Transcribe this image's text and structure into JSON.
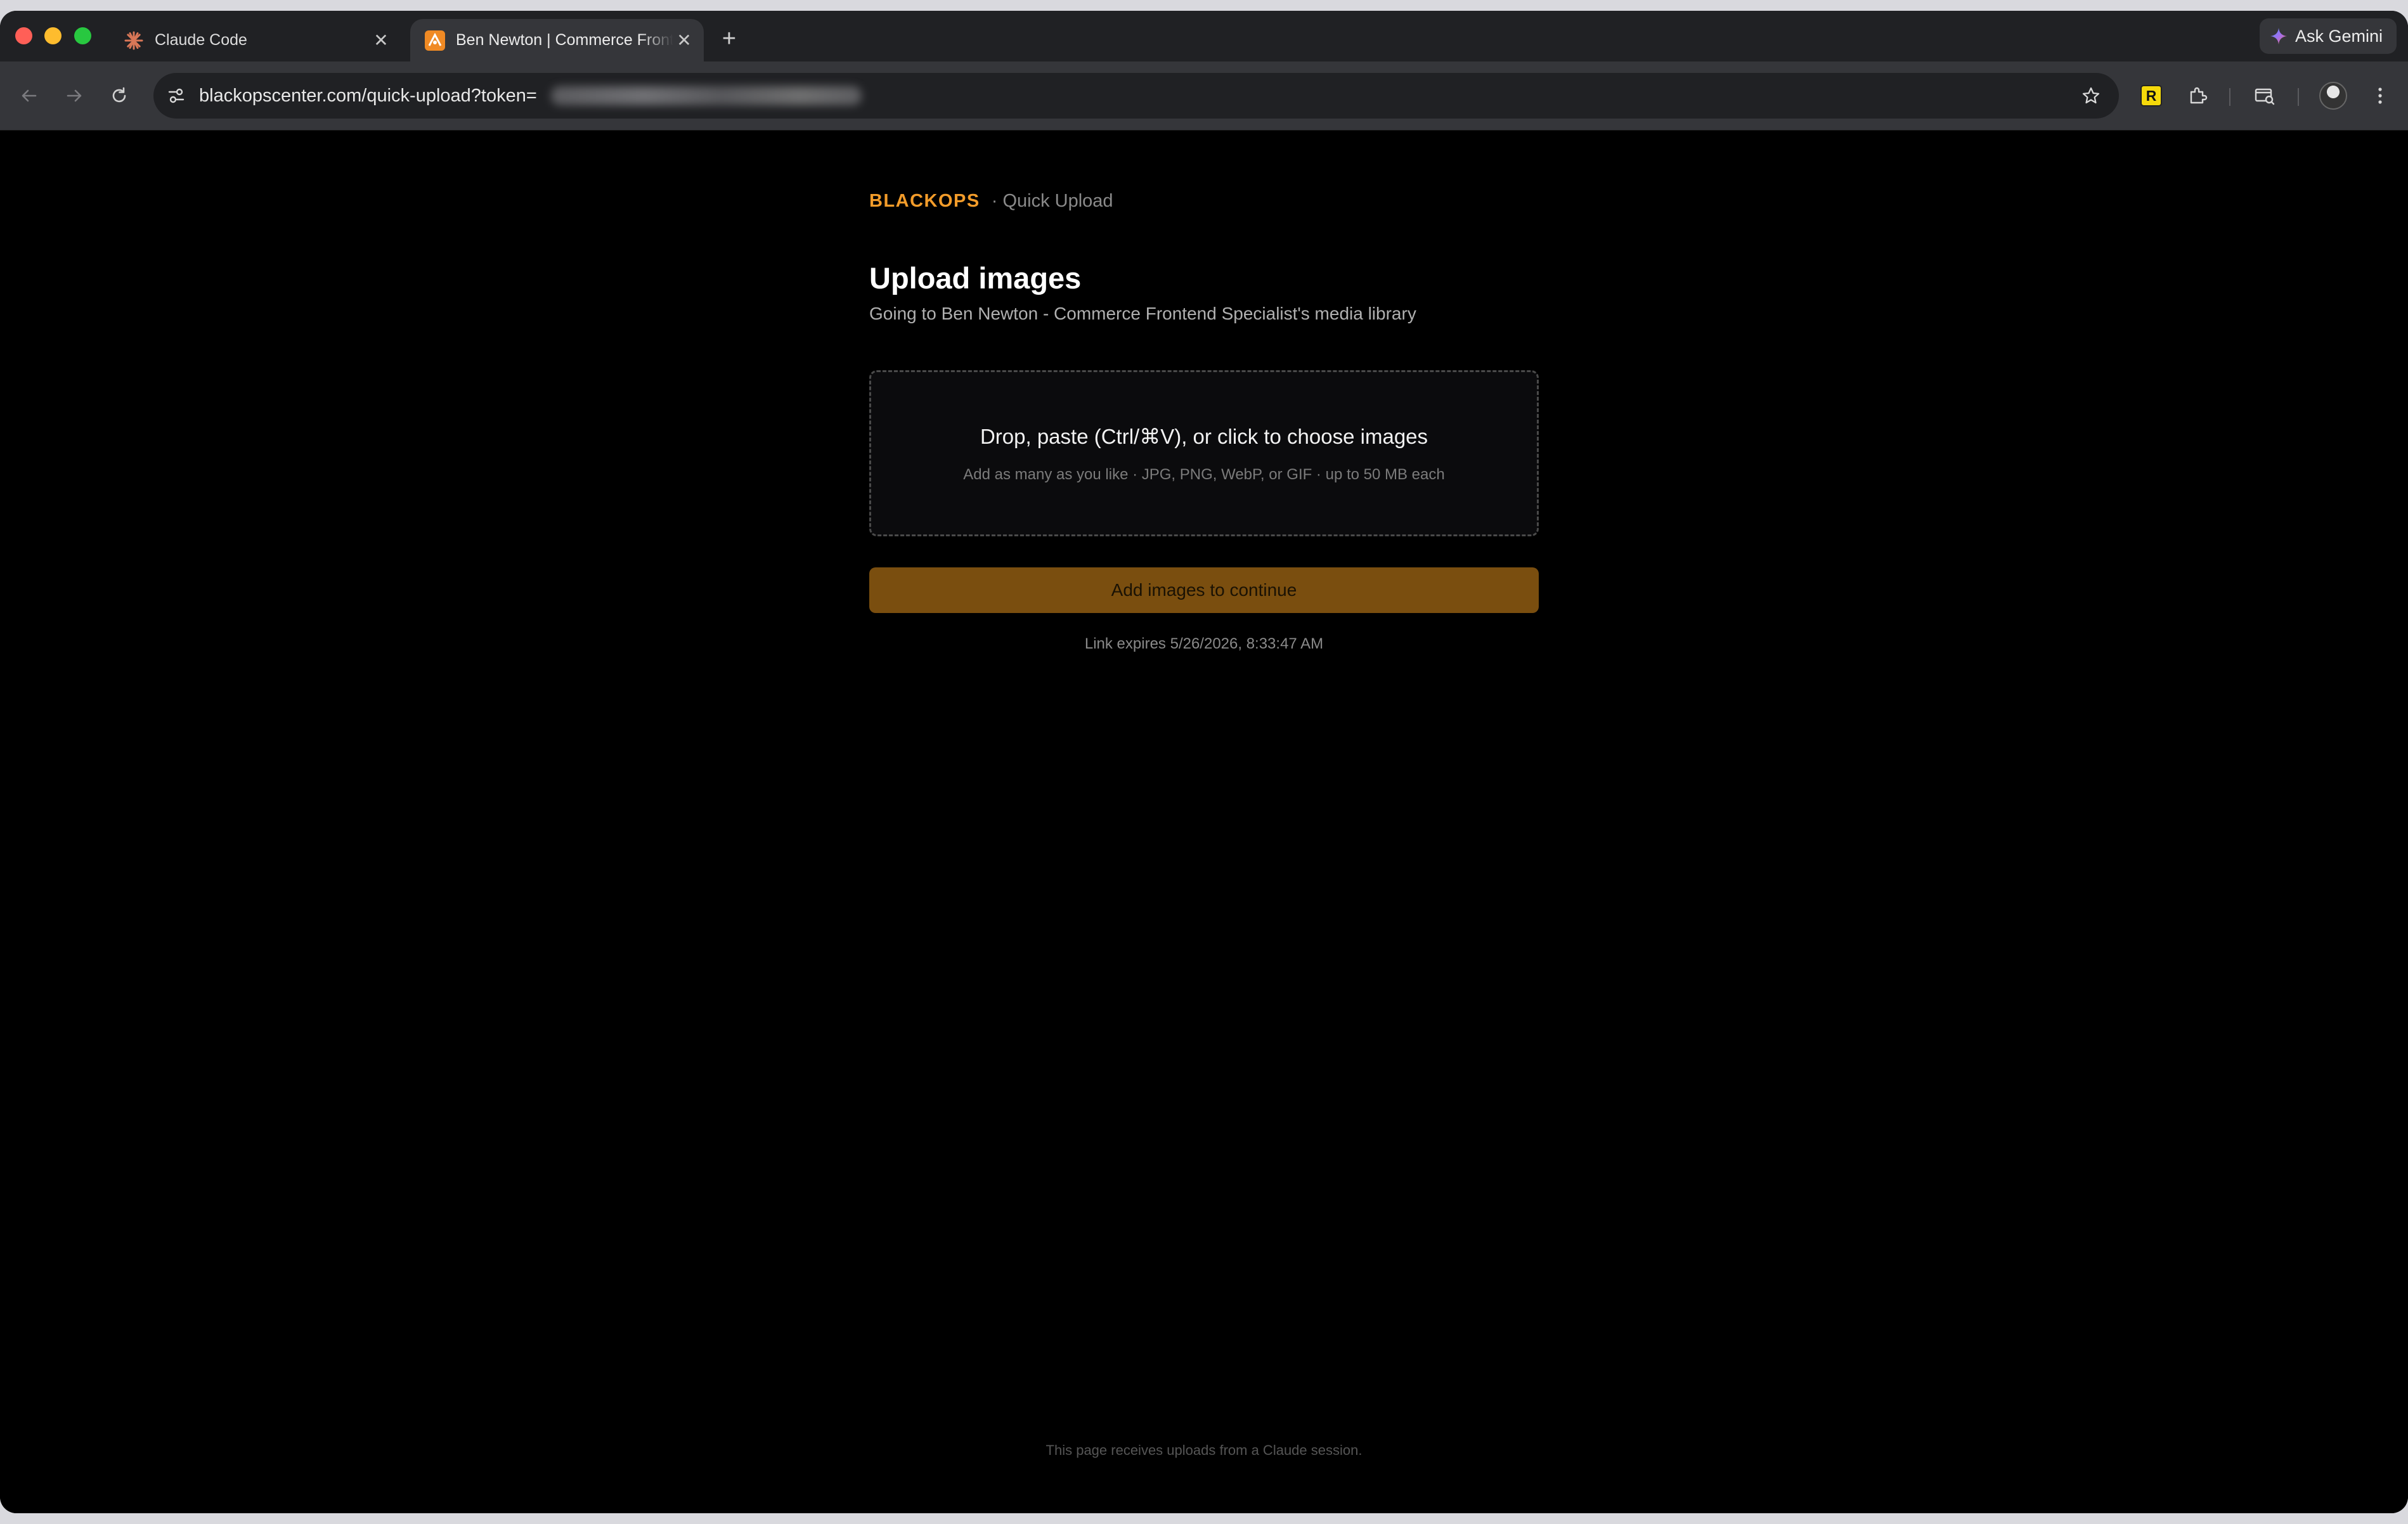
{
  "browser": {
    "tabs": [
      {
        "label": "Claude Code",
        "favicon": "claude-starburst-icon",
        "active": false
      },
      {
        "label": "Ben Newton | Commerce Frontend Specialist",
        "favicon": "site-favicon",
        "active": true
      }
    ],
    "ask_gemini_label": "Ask Gemini",
    "address_bar": {
      "url": "blackopscenter.com/quick-upload?token=",
      "token_redacted": true
    },
    "extensions": [
      "r-extension-icon",
      "puzzle-extensions-icon",
      "tab-search-icon",
      "profile-avatar"
    ]
  },
  "page": {
    "brand": "BLACKOPS",
    "brand_suffix": "· Quick Upload",
    "title": "Upload images",
    "subtitle": "Going to Ben Newton - Commerce Frontend Specialist's media library",
    "dropzone": {
      "title": "Drop, paste (Ctrl/⌘V), or click to choose images",
      "hint": "Add as many as you like · JPG, PNG, WebP, or GIF · up to 50 MB each"
    },
    "submit_label": "Add images to continue",
    "expires": "Link expires 5/26/2026, 8:33:47 AM",
    "footer": "This page receives uploads from a Claude session."
  },
  "colors": {
    "brand": "#f39c2a",
    "button_bg": "#7a4e0f",
    "page_bg": "#000000"
  }
}
